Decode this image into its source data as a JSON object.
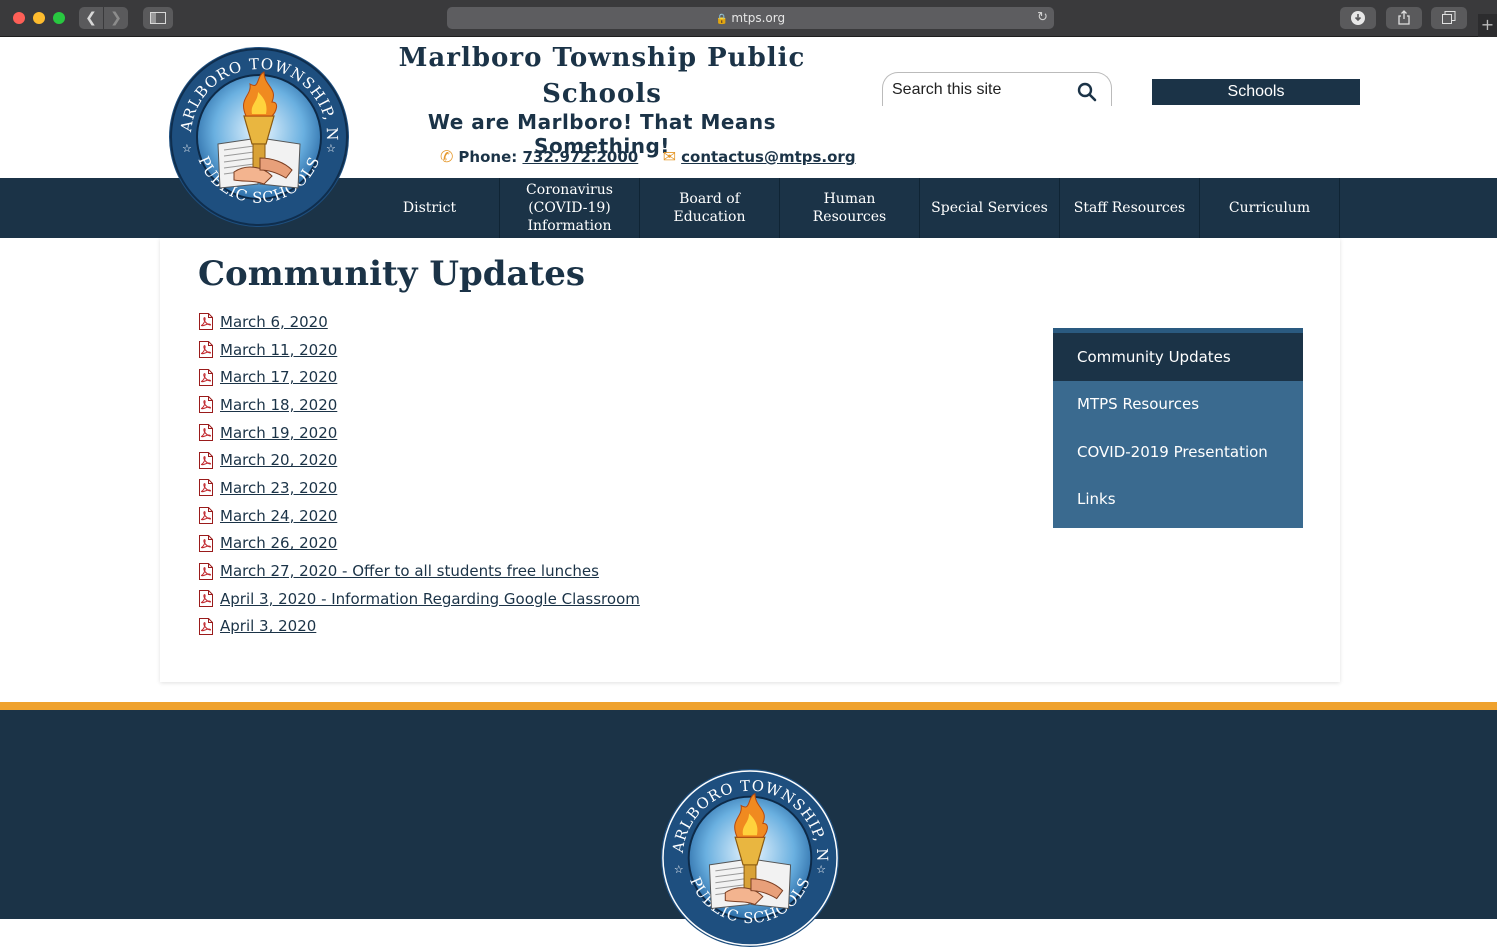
{
  "browser": {
    "url": "mtps.org"
  },
  "header": {
    "title": "Marlboro Township Public Schools",
    "tagline": "We are Marlboro! That Means Something!",
    "phone_label": "Phone:",
    "phone": "732.972.2000",
    "email": "contactus@mtps.org",
    "logo_ring_top": "MARLBORO TOWNSHIP, NJ",
    "logo_ring_bottom": "PUBLIC SCHOOLS"
  },
  "search": {
    "placeholder": "Search this site"
  },
  "schools_button": "Schools",
  "nav": [
    {
      "label": "District"
    },
    {
      "label": "Coronavirus (COVID-19) Information"
    },
    {
      "label": "Board of Education"
    },
    {
      "label": "Human Resources"
    },
    {
      "label": "Special Services"
    },
    {
      "label": "Staff Resources"
    },
    {
      "label": "Curriculum"
    }
  ],
  "page": {
    "title": "Community Updates",
    "documents": [
      "March 6, 2020",
      "March 11, 2020",
      "March 17, 2020",
      "March 18, 2020",
      "March 19, 2020",
      "March 20, 2020",
      "March 23, 2020",
      "March 24, 2020",
      "March 26, 2020",
      "March 27, 2020 - Offer to all students free lunches",
      "April 3, 2020 - Information Regarding Google Classroom",
      "April 3, 2020"
    ]
  },
  "side_menu": {
    "items": [
      {
        "label": "Community Updates",
        "active": true
      },
      {
        "label": "MTPS Resources",
        "active": false
      },
      {
        "label": "COVID-2019 Presentation",
        "active": false
      },
      {
        "label": "Links",
        "active": false
      }
    ]
  },
  "colors": {
    "brand_navy": "#1b3347",
    "accent_orange": "#efa22e",
    "side_menu_blue": "#3a6a8f"
  }
}
